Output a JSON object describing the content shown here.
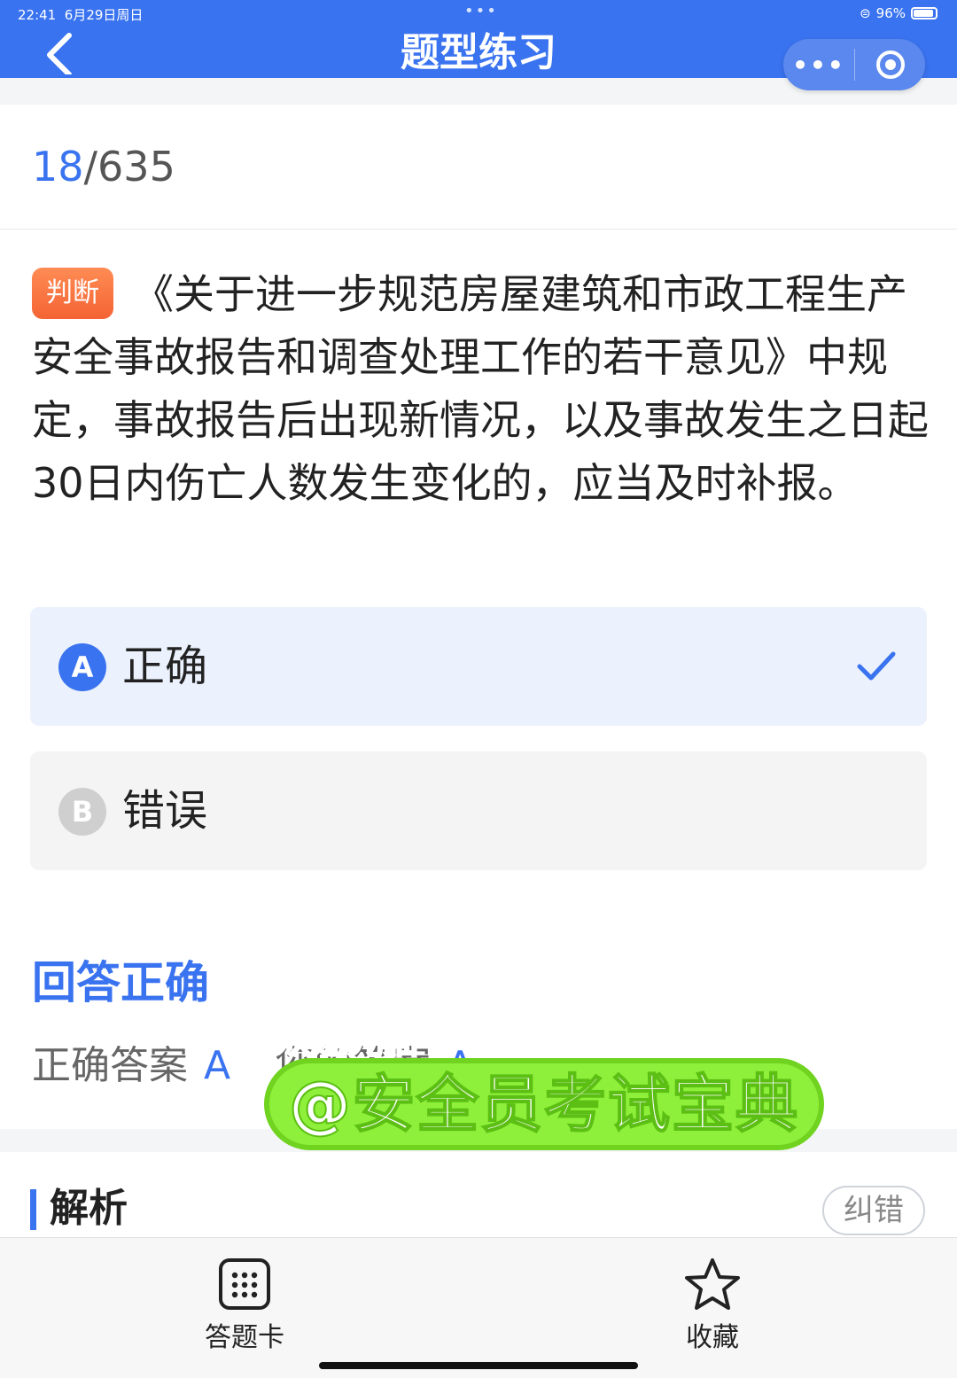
{
  "status_bar": {
    "time": "22:41",
    "date": "6月29日周日",
    "battery": "96%"
  },
  "nav": {
    "title": "题型练习",
    "back_icon": "chevron-left-icon",
    "more_icon": "ellipsis-icon",
    "close_icon": "target-icon"
  },
  "progress": {
    "current": "18",
    "total": "/635"
  },
  "question": {
    "type_tag": "判断",
    "text": "《关于进一步规范房屋建筑和市政工程生产安全事故报告和调查处理工作的若干意见》中规定，事故报告后出现新情况，以及事故发生之日起30日内伤亡人数发生变化的，应当及时补报。"
  },
  "options": [
    {
      "letter": "A",
      "label": "正确",
      "selected": true
    },
    {
      "letter": "B",
      "label": "错误",
      "selected": false
    }
  ],
  "result": {
    "title": "回答正确",
    "correct_answer_label": "正确答案",
    "correct_answer_value": "A",
    "your_answer_label": "您的答案",
    "your_answer_value": "A"
  },
  "analysis": {
    "title": "解析",
    "report_button": "纠错"
  },
  "bottom_tabs": [
    {
      "label": "答题卡",
      "icon": "grid-icon"
    },
    {
      "label": "收藏",
      "icon": "star-icon"
    }
  ],
  "overlay": {
    "welcome": "欢迎光临",
    "handle": "@安全员考试宝典"
  },
  "colors": {
    "primary": "#3a73f0",
    "tag": "#f46334",
    "watermark_green": "#8ef03a",
    "watermark_pink": "#ff5a9a"
  }
}
